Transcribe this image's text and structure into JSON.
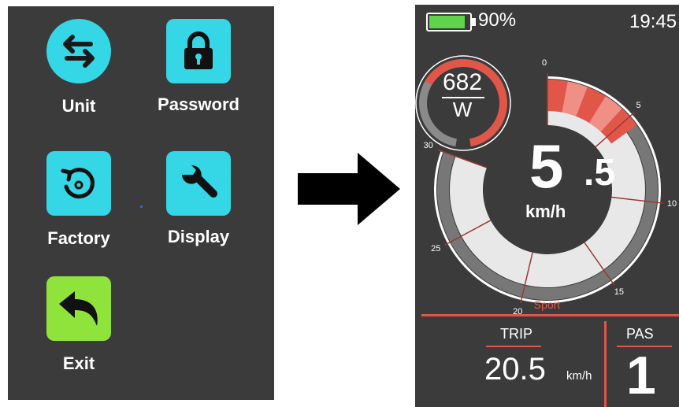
{
  "menu": {
    "items": [
      {
        "label": "Unit",
        "icon": "swap-arrows-icon",
        "color": "#35d6e6"
      },
      {
        "label": "Password",
        "icon": "lock-icon",
        "color": "#35d6e6"
      },
      {
        "label": "Factory",
        "icon": "factory-reset-icon",
        "color": "#35d6e6"
      },
      {
        "label": "Display",
        "icon": "wrench-icon",
        "color": "#35d6e6"
      },
      {
        "label": "Exit",
        "icon": "back-arrow-icon",
        "color": "#8fe33a"
      }
    ]
  },
  "transition": {
    "icon": "right-arrow-icon"
  },
  "dashboard": {
    "battery": {
      "percent_text": "90%",
      "level": 0.9,
      "color": "#5fd34a"
    },
    "clock": "19:45",
    "power": {
      "value": "682",
      "unit": "W"
    },
    "speed": {
      "integer": "5",
      "decimal": ".5",
      "unit": "km/h",
      "value": 5.5
    },
    "speed_ticks": [
      "0",
      "5",
      "10",
      "15",
      "20",
      "25",
      "30"
    ],
    "mode": "Sport",
    "trip": {
      "title": "TRIP",
      "value": "20.5",
      "unit": "km/h"
    },
    "pas": {
      "title": "PAS",
      "value": "1"
    },
    "accent_color": "#e0574a"
  }
}
